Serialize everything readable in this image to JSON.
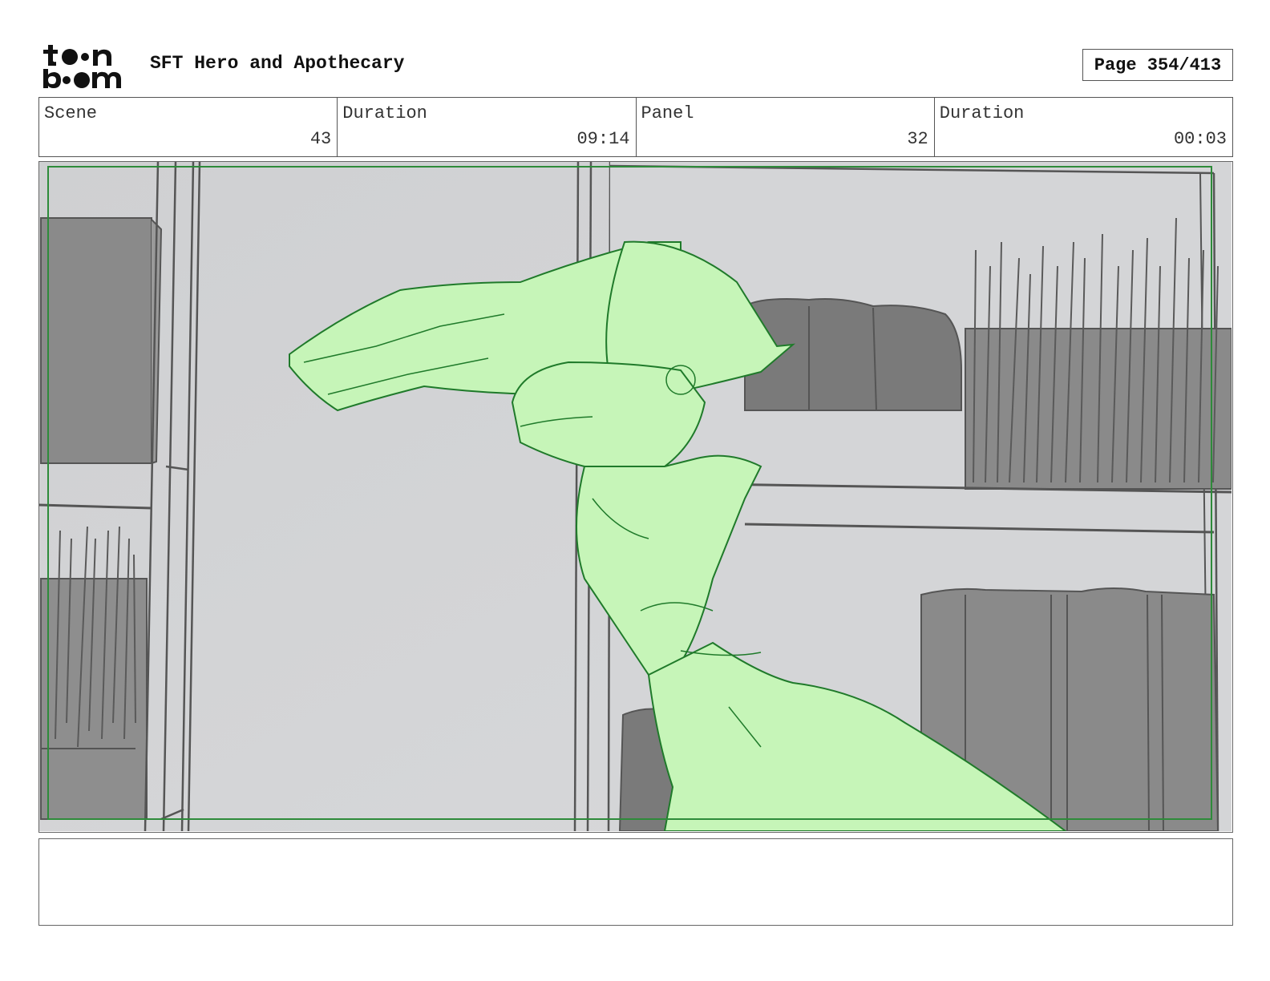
{
  "header": {
    "logo_text": "toon boom",
    "project_title": "SFT Hero and Apothecary",
    "page_indicator": "Page 354/413"
  },
  "info_table": {
    "scene_label": "Scene",
    "scene_value": "43",
    "scene_duration_label": "Duration",
    "scene_duration_value": "09:14",
    "panel_label": "Panel",
    "panel_value": "32",
    "panel_duration_label": "Duration",
    "panel_duration_value": "00:03"
  },
  "panel_image": {
    "description_icon": "storyboard-sketch",
    "colors": {
      "background": "#d2d3d5",
      "shelf_dark": "#8a8a8a",
      "line": "#555555",
      "character_fill": "#c6f5b8",
      "character_line": "#1f7a2a",
      "safe_frame": "#2e8b3a"
    }
  },
  "notes": {
    "text": ""
  }
}
